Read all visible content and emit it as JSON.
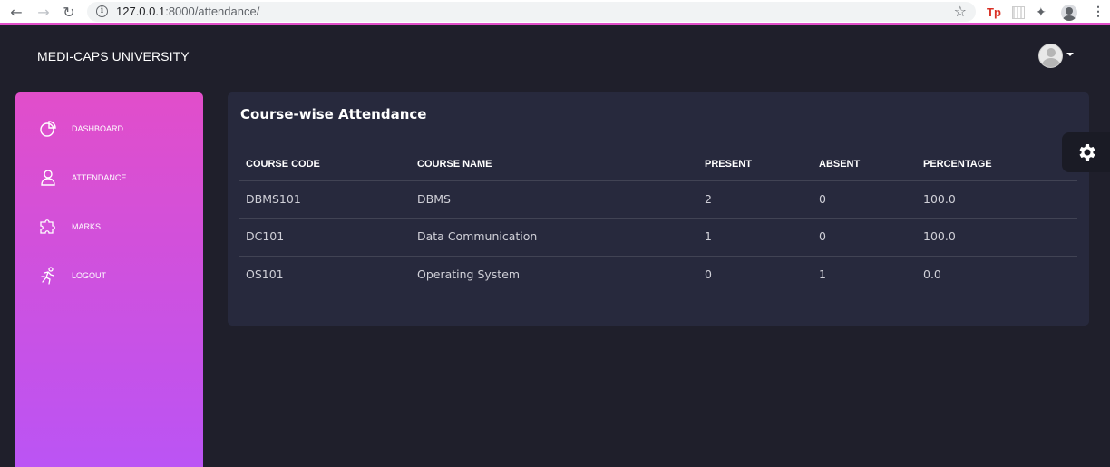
{
  "browser": {
    "url_host": "127.0.0.1",
    "url_path": ":8000/attendance/",
    "extension_tp": "Tp"
  },
  "navbar": {
    "brand": "MEDI-CAPS UNIVERSITY"
  },
  "sidebar": {
    "items": [
      {
        "label": "DASHBOARD",
        "icon": "pie-chart-icon"
      },
      {
        "label": "ATTENDANCE",
        "icon": "user-icon"
      },
      {
        "label": "MARKS",
        "icon": "puzzle-icon"
      },
      {
        "label": "LOGOUT",
        "icon": "runner-icon"
      }
    ]
  },
  "card": {
    "title": "Course-wise Attendance",
    "columns": [
      "COURSE CODE",
      "COURSE NAME",
      "PRESENT",
      "ABSENT",
      "PERCENTAGE"
    ],
    "rows": [
      [
        "DBMS101",
        "DBMS",
        "2",
        "0",
        "100.0"
      ],
      [
        "DC101",
        "Data Communication",
        "1",
        "0",
        "100.0"
      ],
      [
        "OS101",
        "Operating System",
        "0",
        "1",
        "0.0"
      ]
    ]
  },
  "colors": {
    "accent": "#e14eca",
    "accent_end": "#ba54f5",
    "background": "#1f1f2b",
    "card": "#27293d"
  }
}
